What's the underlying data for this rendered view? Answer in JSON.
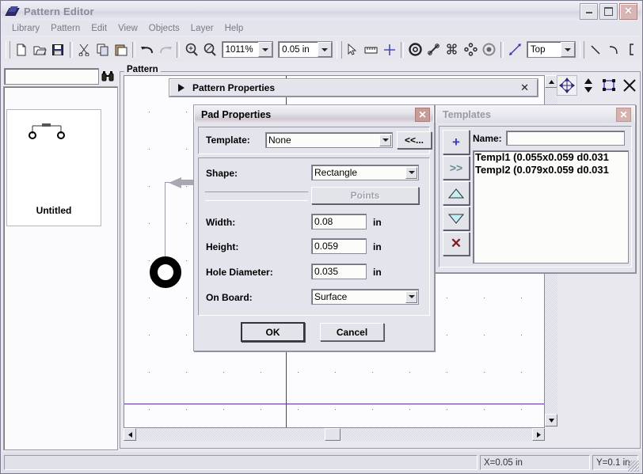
{
  "window": {
    "title": "Pattern Editor",
    "buttons": {
      "minimize": "_",
      "maximize": "□",
      "close": "✕"
    }
  },
  "menubar": {
    "items": [
      "Library",
      "Pattern",
      "Edit",
      "View",
      "Objects",
      "Layer",
      "Help"
    ]
  },
  "toolbar": {
    "icons": [
      "new-file",
      "open-folder",
      "save-disk",
      "cut-scissors",
      "copy",
      "paste",
      "undo",
      "redo",
      "zoom-in",
      "zoom-out"
    ],
    "zoom_value": "1011%",
    "grid_value": "0.05 in",
    "tools": [
      "select-arrow",
      "measure",
      "crosshair",
      "pad",
      "trace",
      "via-array",
      "pin-array",
      "annular-pad",
      "dimension"
    ],
    "layer_value": "Top",
    "draw_tools": [
      "line",
      "arc",
      "bracket"
    ]
  },
  "left_panel": {
    "search_value": "",
    "search_icon": "binoculars-icon",
    "preview_label": "Untitled"
  },
  "canvas": {
    "group_label": "Pattern",
    "pattern_properties_bar": {
      "label": "Pattern Properties",
      "expand_icon": "▶",
      "close_icon": "✕"
    },
    "object_buttons": [
      "move-icon",
      "order-updown-icon",
      "select-box-icon",
      "delete-x-icon"
    ]
  },
  "pad_dialog": {
    "title": "Pad Properties",
    "close": "✕",
    "template_label": "Template:",
    "template_value": "None",
    "template_browse": "<<...",
    "shape_label": "Shape:",
    "shape_value": "Rectangle",
    "points_button": "Points",
    "width_label": "Width:",
    "width_value": "0.08",
    "width_unit": "in",
    "height_label": "Height:",
    "height_value": "0.059",
    "height_unit": "in",
    "hole_label": "Hole Diameter:",
    "hole_value": "0.035",
    "hole_unit": "in",
    "onboard_label": "On Board:",
    "onboard_value": "Surface",
    "ok": "OK",
    "cancel": "Cancel"
  },
  "templates_dialog": {
    "title": "Templates",
    "close": "✕",
    "name_label": "Name:",
    "name_value": "",
    "buttons": {
      "add": "+",
      "apply": ">>",
      "move_up": "▲",
      "move_down": "▼",
      "delete": "✕"
    },
    "items": [
      "Templ1 (0.055x0.059 d0.031",
      "Templ2 (0.079x0.059 d0.031"
    ]
  },
  "statusbar": {
    "left": "",
    "x": "X=0.05 in",
    "y": "Y=0.1 in"
  },
  "colors": {
    "axis": "#5b2fa8",
    "dialog_face": "#e4e4ec",
    "accent_blue": "#3a3ac8",
    "delete_red": "#7a2020"
  }
}
